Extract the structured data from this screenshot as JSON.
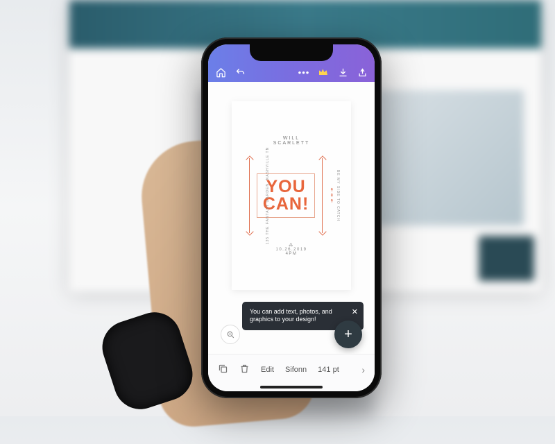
{
  "card": {
    "name_line1": "WILL",
    "name_line2": "SCARLETT",
    "headline_line1": "YOU",
    "headline_line2": "CAN!",
    "detail_date": "10.26.2019",
    "detail_time": "4PM",
    "side_left": "135 THE FANTASY GARDEN, NASHVILLE TN",
    "side_right": "BE MY SIDE TO CATCH"
  },
  "tooltip": {
    "text": "You can add text, photos, and graphics to your design!",
    "close_aria": "Close tip"
  },
  "bottom_bar": {
    "edit_label": "Edit",
    "font_name": "Sifonn",
    "font_size": "141 pt"
  },
  "icons": {
    "home": "home-icon",
    "undo": "undo-icon",
    "more": "more-icon",
    "crown": "crown-icon",
    "download": "download-icon",
    "share": "share-icon",
    "zoom": "zoom-icon",
    "plus": "plus-icon",
    "copy": "copy-icon",
    "trash": "trash-icon",
    "chevron": "chevron-right-icon"
  }
}
